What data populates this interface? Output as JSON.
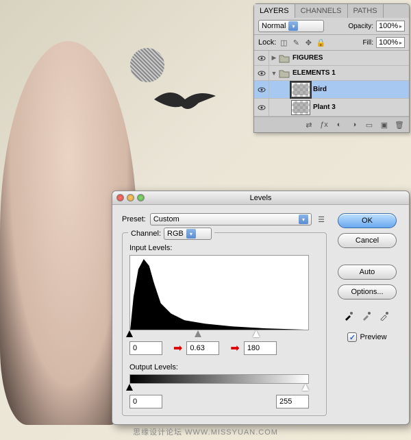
{
  "layers_panel": {
    "tabs": [
      "LAYERS",
      "CHANNELS",
      "PATHS"
    ],
    "blend_mode": "Normal",
    "opacity_label": "Opacity:",
    "opacity_value": "100%",
    "lock_label": "Lock:",
    "fill_label": "Fill:",
    "fill_value": "100%",
    "groups": [
      {
        "name": "FIGURES",
        "expanded": false
      },
      {
        "name": "ELEMENTS 1",
        "expanded": true
      }
    ],
    "layers": [
      {
        "name": "Bird",
        "selected": true
      },
      {
        "name": "Plant 3",
        "selected": false
      }
    ]
  },
  "levels": {
    "title": "Levels",
    "preset_label": "Preset:",
    "preset_value": "Custom",
    "channel_label": "Channel:",
    "channel_value": "RGB",
    "input_label": "Input Levels:",
    "input_black": "0",
    "input_gamma": "0.63",
    "input_white": "180",
    "output_label": "Output Levels:",
    "output_black": "0",
    "output_white": "255",
    "ok": "OK",
    "cancel": "Cancel",
    "auto": "Auto",
    "options": "Options...",
    "preview_label": "Preview"
  },
  "watermark": "思缘设计论坛  WWW.MISSYUAN.COM"
}
